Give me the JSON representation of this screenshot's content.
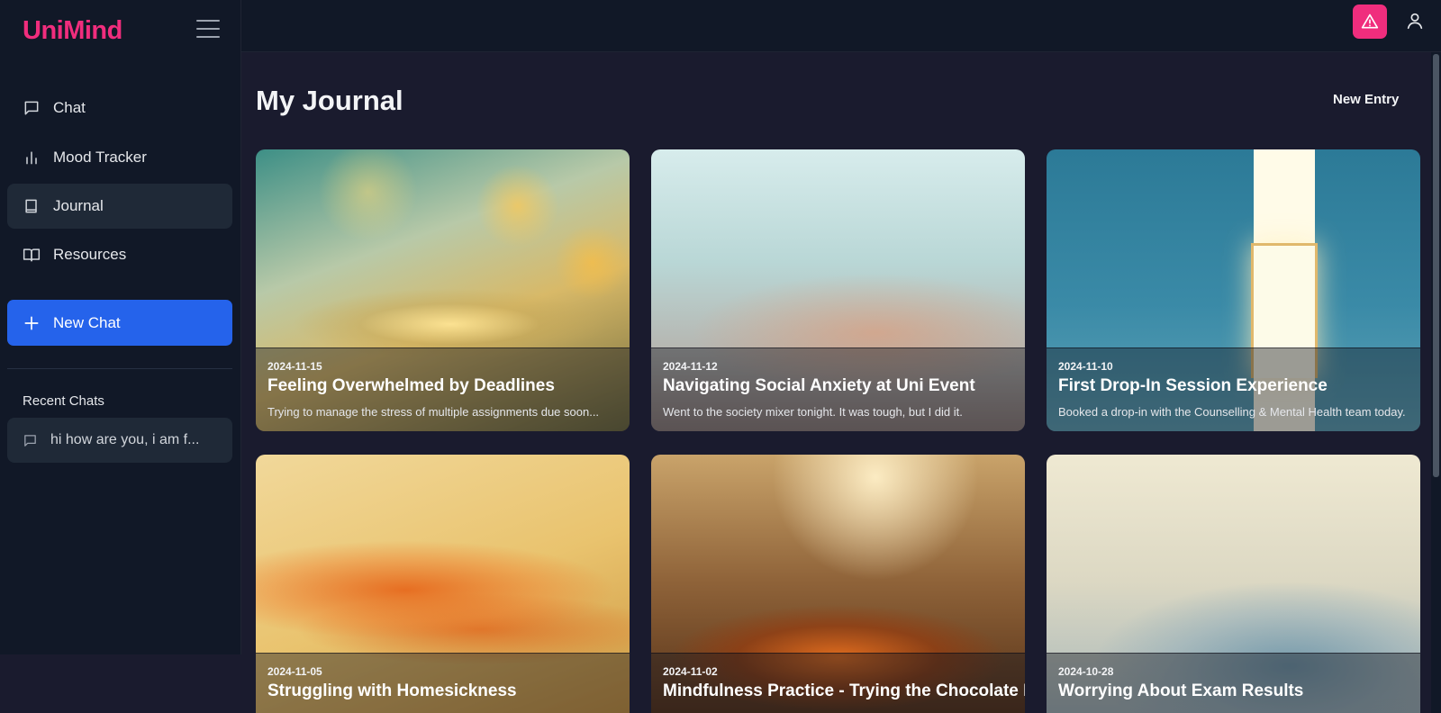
{
  "app": {
    "name": "UniMind"
  },
  "sidebar": {
    "items": [
      {
        "label": "Chat",
        "icon": "chat-icon"
      },
      {
        "label": "Mood Tracker",
        "icon": "bar-chart-icon"
      },
      {
        "label": "Journal",
        "icon": "notebook-icon",
        "active": true
      },
      {
        "label": "Resources",
        "icon": "open-book-icon"
      }
    ],
    "new_chat_label": "New Chat",
    "recent_title": "Recent Chats",
    "recent_chats": [
      {
        "label": "hi how are you, i am f..."
      }
    ]
  },
  "header": {
    "alert_icon": "warning-icon",
    "user_icon": "user-icon"
  },
  "main": {
    "title": "My Journal",
    "new_entry_label": "New Entry",
    "entries": [
      {
        "date": "2024-11-15",
        "title": "Feeling Overwhelmed by Deadlines",
        "snippet": "Trying to manage the stress of multiple assignments due soon..."
      },
      {
        "date": "2024-11-12",
        "title": "Navigating Social Anxiety at Uni Event",
        "snippet": "Went to the society mixer tonight. It was tough, but I did it."
      },
      {
        "date": "2024-11-10",
        "title": "First Drop-In Session Experience",
        "snippet": "Booked a drop-in with the Counselling & Mental Health team today."
      },
      {
        "date": "2024-11-05",
        "title": "Struggling with Homesickness",
        "snippet": ""
      },
      {
        "date": "2024-11-02",
        "title": "Mindfulness Practice - Trying the Chocolate M",
        "snippet": ""
      },
      {
        "date": "2024-10-28",
        "title": "Worrying About Exam Results",
        "snippet": ""
      }
    ]
  },
  "colors": {
    "brand": "#f02d7d",
    "primary": "#2563eb",
    "sidebar_bg": "#111827",
    "page_bg": "#1a1b2e"
  }
}
